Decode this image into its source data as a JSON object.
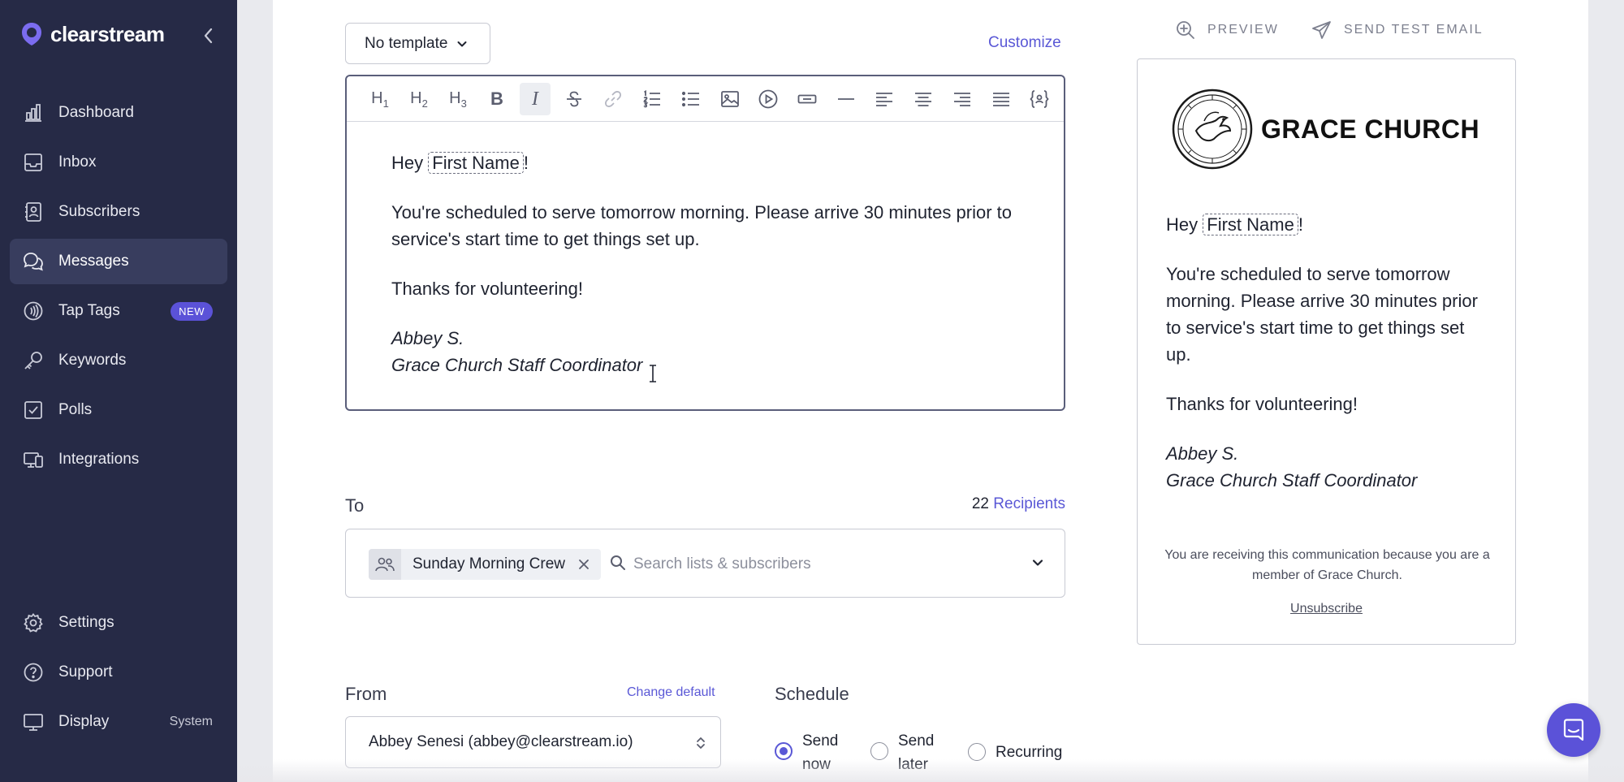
{
  "app": {
    "logo_text": "clearstream"
  },
  "sidebar": {
    "items": [
      {
        "label": "Dashboard",
        "icon": "chart-icon"
      },
      {
        "label": "Inbox",
        "icon": "inbox-icon"
      },
      {
        "label": "Subscribers",
        "icon": "contact-icon"
      },
      {
        "label": "Messages",
        "icon": "messages-icon",
        "active": true
      },
      {
        "label": "Tap Tags",
        "icon": "nfc-icon",
        "badge": "NEW"
      },
      {
        "label": "Keywords",
        "icon": "key-icon"
      },
      {
        "label": "Polls",
        "icon": "checkbox-icon"
      },
      {
        "label": "Integrations",
        "icon": "devices-icon"
      }
    ],
    "bottom_items": [
      {
        "label": "Settings",
        "icon": "gear-icon"
      },
      {
        "label": "Support",
        "icon": "help-icon"
      },
      {
        "label": "Display",
        "icon": "monitor-icon",
        "meta": "System"
      }
    ]
  },
  "composer": {
    "template_select": "No template",
    "customize_label": "Customize",
    "editor": {
      "greeting_prefix": "Hey",
      "merge_tag": "First Name",
      "greeting_suffix": "!",
      "paragraph1": "You're scheduled to serve tomorrow morning. Please arrive 30 minutes prior to service's start time to get things set up.",
      "paragraph2": "Thanks for volunteering!",
      "signature_name": "Abbey S.",
      "signature_title": "Grace Church Staff Coordinator"
    },
    "toolbar": [
      "H1",
      "H2",
      "H3",
      "bold",
      "italic",
      "strikethrough",
      "link",
      "ordered-list",
      "bullet-list",
      "image",
      "video",
      "button",
      "divider",
      "align-left",
      "align-center",
      "align-right",
      "justify",
      "merge-field"
    ],
    "toolbar_text": {
      "h1": "H",
      "h1_sub": "1",
      "h2": "H",
      "h2_sub": "2",
      "h3": "H",
      "h3_sub": "3",
      "bold": "B",
      "italic": "I"
    }
  },
  "to": {
    "label": "To",
    "recipient_count": "22",
    "recipient_label": "Recipients",
    "chip_label": "Sunday Morning Crew",
    "search_placeholder": "Search lists & subscribers"
  },
  "from": {
    "label": "From",
    "change_default": "Change default",
    "value": "Abbey Senesi (abbey@clearstream.io)"
  },
  "schedule": {
    "label": "Schedule",
    "options": [
      {
        "label_line1": "Send",
        "label_line2": "now",
        "checked": true
      },
      {
        "label_line1": "Send",
        "label_line2": "later",
        "checked": false
      },
      {
        "label_line1": "Recurring",
        "label_line2": "",
        "checked": false
      }
    ]
  },
  "preview": {
    "preview_label": "PREVIEW",
    "send_test_label": "SEND TEST EMAIL",
    "church_name": "GRACE CHURCH",
    "greeting_prefix": "Hey",
    "merge_tag": "First Name",
    "greeting_suffix": "!",
    "paragraph1": "You're scheduled to serve tomorrow morning. Please arrive 30 minutes prior to service's start time to get things set up.",
    "paragraph2": "Thanks for volunteering!",
    "signature_name": "Abbey S.",
    "signature_title": "Grace Church Staff Coordinator",
    "footer_text": "You are receiving this communication because you are a member of Grace Church.",
    "unsubscribe": "Unsubscribe"
  },
  "colors": {
    "sidebar_bg": "#262a46",
    "accent": "#5a58d6",
    "badge": "#5b52d8"
  }
}
